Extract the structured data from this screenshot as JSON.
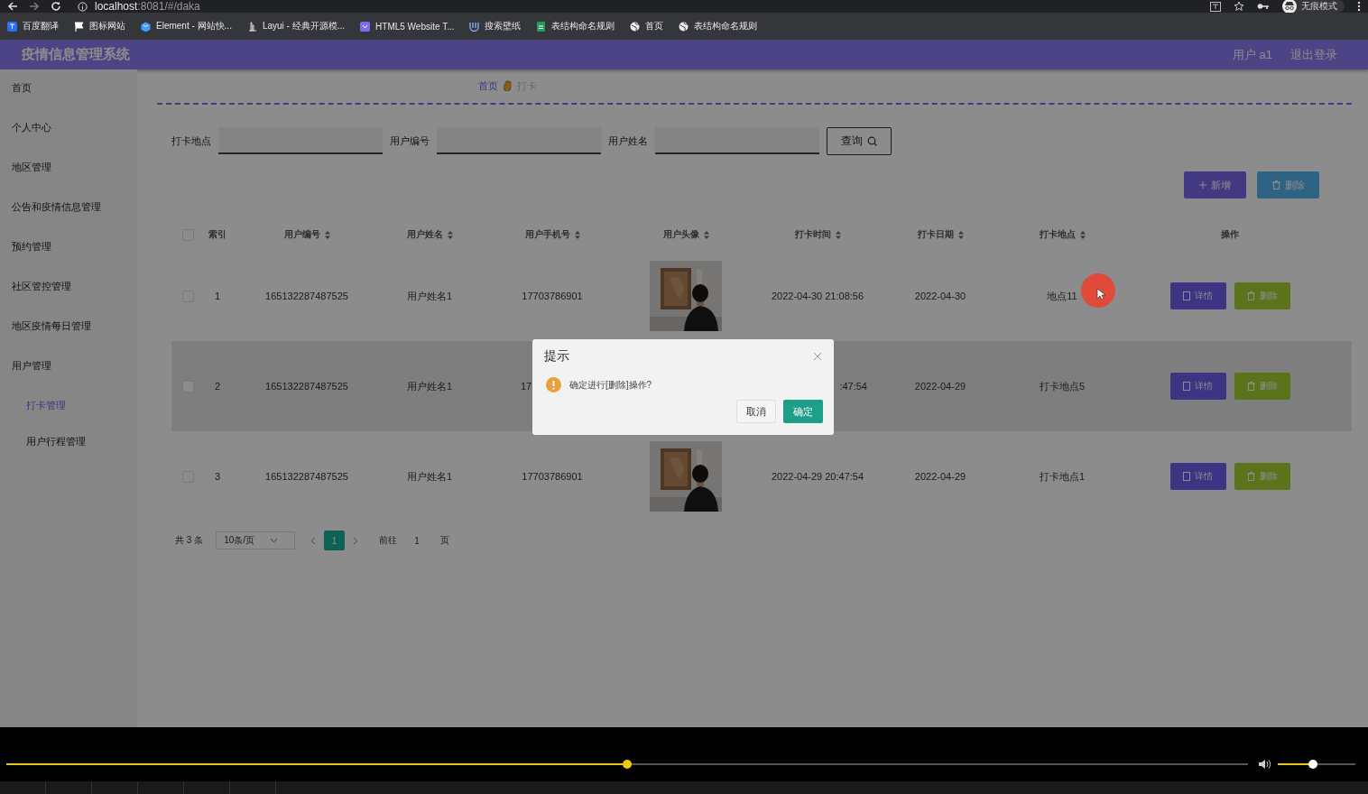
{
  "browser": {
    "url_host": "localhost",
    "url_rest": ":8081/#/daka",
    "profile": "无痕模式",
    "bookmarks": [
      {
        "kind": "translate",
        "label": "百度翻译"
      },
      {
        "kind": "flag",
        "label": "图标网站"
      },
      {
        "kind": "hexagon",
        "label": "Element - 网站快..."
      },
      {
        "kind": "layui",
        "label": "Layui - 经典开源模..."
      },
      {
        "kind": "html5",
        "label": "HTML5 Website T..."
      },
      {
        "kind": "wallpaper",
        "label": "搜索壁纸"
      },
      {
        "kind": "sheet",
        "label": "表结构命名规则"
      },
      {
        "kind": "globe",
        "label": "首页"
      },
      {
        "kind": "globe",
        "label": "表结构命名规则"
      }
    ]
  },
  "app": {
    "title": "疫情信息管理系统",
    "user": "用户 a1",
    "logout": "退出登录"
  },
  "sidebar": {
    "items": [
      {
        "label": "首页",
        "selected": false
      },
      {
        "label": "个人中心",
        "selected": false
      },
      {
        "label": "地区管理",
        "selected": false
      },
      {
        "label": "公告和疫情信息管理",
        "selected": false
      },
      {
        "label": "预约管理",
        "selected": false
      },
      {
        "label": "社区管控管理",
        "selected": false
      },
      {
        "label": "地区疫情每日管理",
        "selected": false
      },
      {
        "label": "用户管理",
        "selected": false,
        "children": [
          {
            "label": "打卡管理",
            "selected": true
          },
          {
            "label": "用户行程管理",
            "selected": false
          }
        ]
      }
    ]
  },
  "breadcrumb": [
    "首页",
    "打卡"
  ],
  "search": {
    "fields": [
      {
        "label": "打卡地点"
      },
      {
        "label": "用户编号"
      },
      {
        "label": "用户姓名"
      }
    ],
    "button": "查询"
  },
  "actions": [
    {
      "kind": "add",
      "label": "新增"
    },
    {
      "kind": "delete",
      "label": "删除"
    }
  ],
  "table": {
    "select_all": {
      "checked": false
    },
    "columns": [
      {
        "label": "索引",
        "sortable": false
      },
      {
        "label": "用户编号",
        "sortable": true
      },
      {
        "label": "用户姓名",
        "sortable": true
      },
      {
        "label": "用户手机号",
        "sortable": true
      },
      {
        "label": "用户头像",
        "sortable": true
      },
      {
        "label": "打卡时间",
        "sortable": true
      },
      {
        "label": "打卡日期",
        "sortable": true
      },
      {
        "label": "打卡地点",
        "sortable": true
      },
      {
        "label": "操作",
        "sortable": false
      }
    ],
    "rows": [
      {
        "checked": false,
        "hovered": false,
        "covered": false,
        "cells": [
          "1",
          "165132287487525",
          "用户姓名1",
          "17703786901",
          {
            "kind": "picture"
          },
          "2022-04-30 21:08:56",
          "2022-04-30",
          "地点11",
          {
            "kind": "buttons",
            "labels": [
              "详情",
              "删除"
            ]
          }
        ]
      },
      {
        "checked": false,
        "hovered": true,
        "covered": true,
        "cells": [
          "2",
          "165132287487525",
          "用户姓名1",
          "17",
          "",
          ":47:54",
          "2022-04-29",
          "打卡地点5",
          {
            "kind": "buttons",
            "labels": [
              "详情",
              "删除"
            ]
          }
        ]
      },
      {
        "checked": false,
        "hovered": false,
        "covered": false,
        "cells": [
          "3",
          "165132287487525",
          "用户姓名1",
          "17703786901",
          {
            "kind": "picture"
          },
          "2022-04-29 20:47:54",
          "2022-04-29",
          "打卡地点1",
          {
            "kind": "buttons",
            "labels": [
              "详情",
              "删除"
            ]
          }
        ]
      }
    ]
  },
  "pagination": {
    "total": "共 3 条",
    "page_size": "10条/页",
    "pages": [
      {
        "label": "1",
        "selected": true
      }
    ],
    "goto_label": "前往",
    "goto_value": "1",
    "goto_unit": "页"
  },
  "dialog": {
    "title": "提示",
    "message": "确定进行[删除]操作?",
    "cancel": "取消",
    "confirm": "确定"
  },
  "player": {
    "progress": {
      "level": 0.5
    },
    "volume": {
      "level": 0.45
    }
  }
}
